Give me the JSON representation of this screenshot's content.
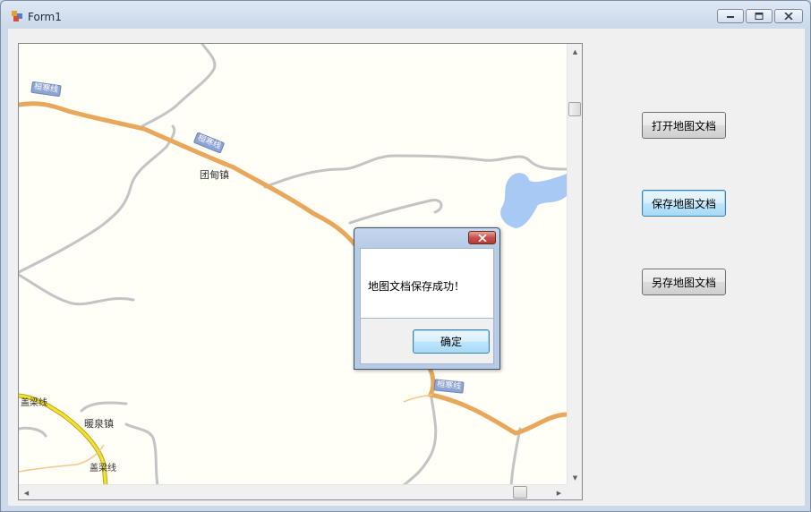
{
  "window": {
    "title": "Form1"
  },
  "map": {
    "labels": {
      "town1": "团甸镇",
      "town2": "暖泉镇",
      "road_gaiLiang_1": "盖梁线",
      "road_gaiLiang_2": "盖梁线",
      "road_tag_1": "桓寒线",
      "road_tag_2": "桓寒线",
      "road_tag_3": "桓寒线"
    },
    "colors": {
      "background": "#fffef7",
      "main_road": "#e8a75a",
      "minor_road": "#c8c8c8",
      "highway_yellow": "#f3e132",
      "water": "#a9c9f5"
    }
  },
  "buttons": {
    "open": "打开地图文档",
    "save": "保存地图文档",
    "save_as": "另存地图文档"
  },
  "dialog": {
    "message": "地图文档保存成功！",
    "ok": "确定"
  }
}
